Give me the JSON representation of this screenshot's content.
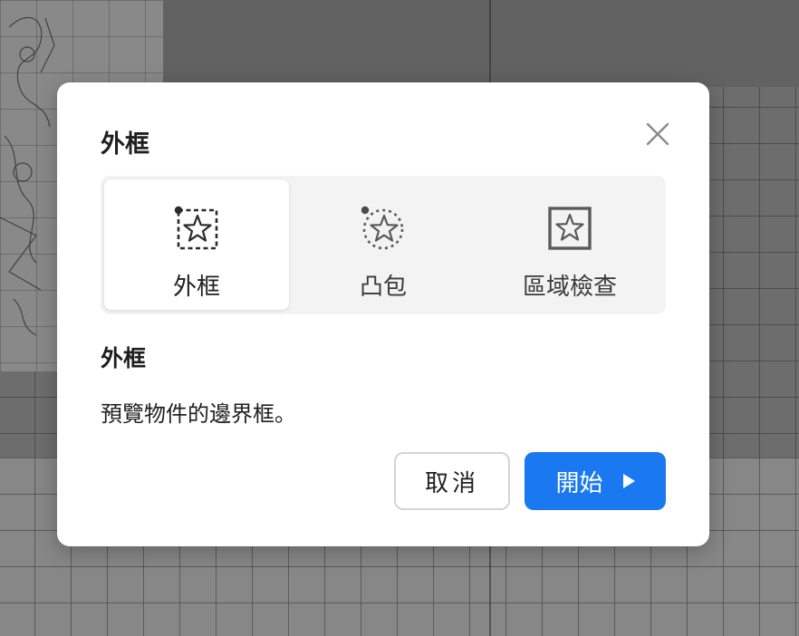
{
  "dialog": {
    "title": "外框",
    "close_icon": "close-icon"
  },
  "modes": [
    {
      "label": "外框",
      "icon": "bounding-box-star-icon",
      "selected": true
    },
    {
      "label": "凸包",
      "icon": "convex-hull-star-icon",
      "selected": false
    },
    {
      "label": "區域檢查",
      "icon": "region-check-star-icon",
      "selected": false
    }
  ],
  "detail": {
    "heading": "外框",
    "description": "預覽物件的邊界框。"
  },
  "buttons": {
    "cancel_label": "取消",
    "start_label": "開始",
    "start_icon": "play-icon"
  },
  "colors": {
    "primary": "#1a78f0",
    "segment_bg": "#f3f3f4"
  }
}
